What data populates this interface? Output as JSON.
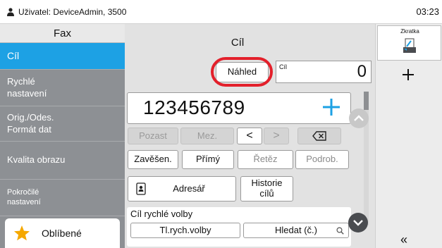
{
  "status": {
    "user": "Uživatel: DeviceAdmin, 3500",
    "time": "03:23"
  },
  "sidebar": {
    "title": "Fax",
    "items": [
      {
        "label": "Cíl"
      },
      {
        "label": "Rychlé\nnastavení"
      },
      {
        "label": "Orig./Odes.\nFormát dat"
      },
      {
        "label": "Kvalita obrazu"
      },
      {
        "label": "Pokročilé\nnastavení"
      }
    ],
    "favorites": "Oblíbené"
  },
  "main": {
    "title": "Cíl",
    "preview": "Náhled",
    "count_label": "Cíl",
    "count_value": "0",
    "number": "123456789",
    "edit_buttons": {
      "pause": "Pozast",
      "space": "Mez.",
      "left": "<",
      "right": ">"
    },
    "options": {
      "on_hook": "Zavěšen.",
      "direct": "Přímý",
      "chain": "Řetěz",
      "detail": "Podrob."
    },
    "address_book": "Adresář",
    "history": "Historie\ncílů",
    "speed_dial_label": "Cíl rychlé volby",
    "speed_dial_button": "Tl.rych.volby",
    "search_button": "Hledat (č.)"
  },
  "right_panel": {
    "shortcut_label": "Zkratka",
    "add_icon": "plus-icon",
    "collapse": "«"
  },
  "colors": {
    "accent": "#1da1e4",
    "highlight_ring": "#e3202b",
    "plus": "#1da1e4",
    "sidebar": "#8d9094",
    "favorite_star": "#f5a800"
  }
}
